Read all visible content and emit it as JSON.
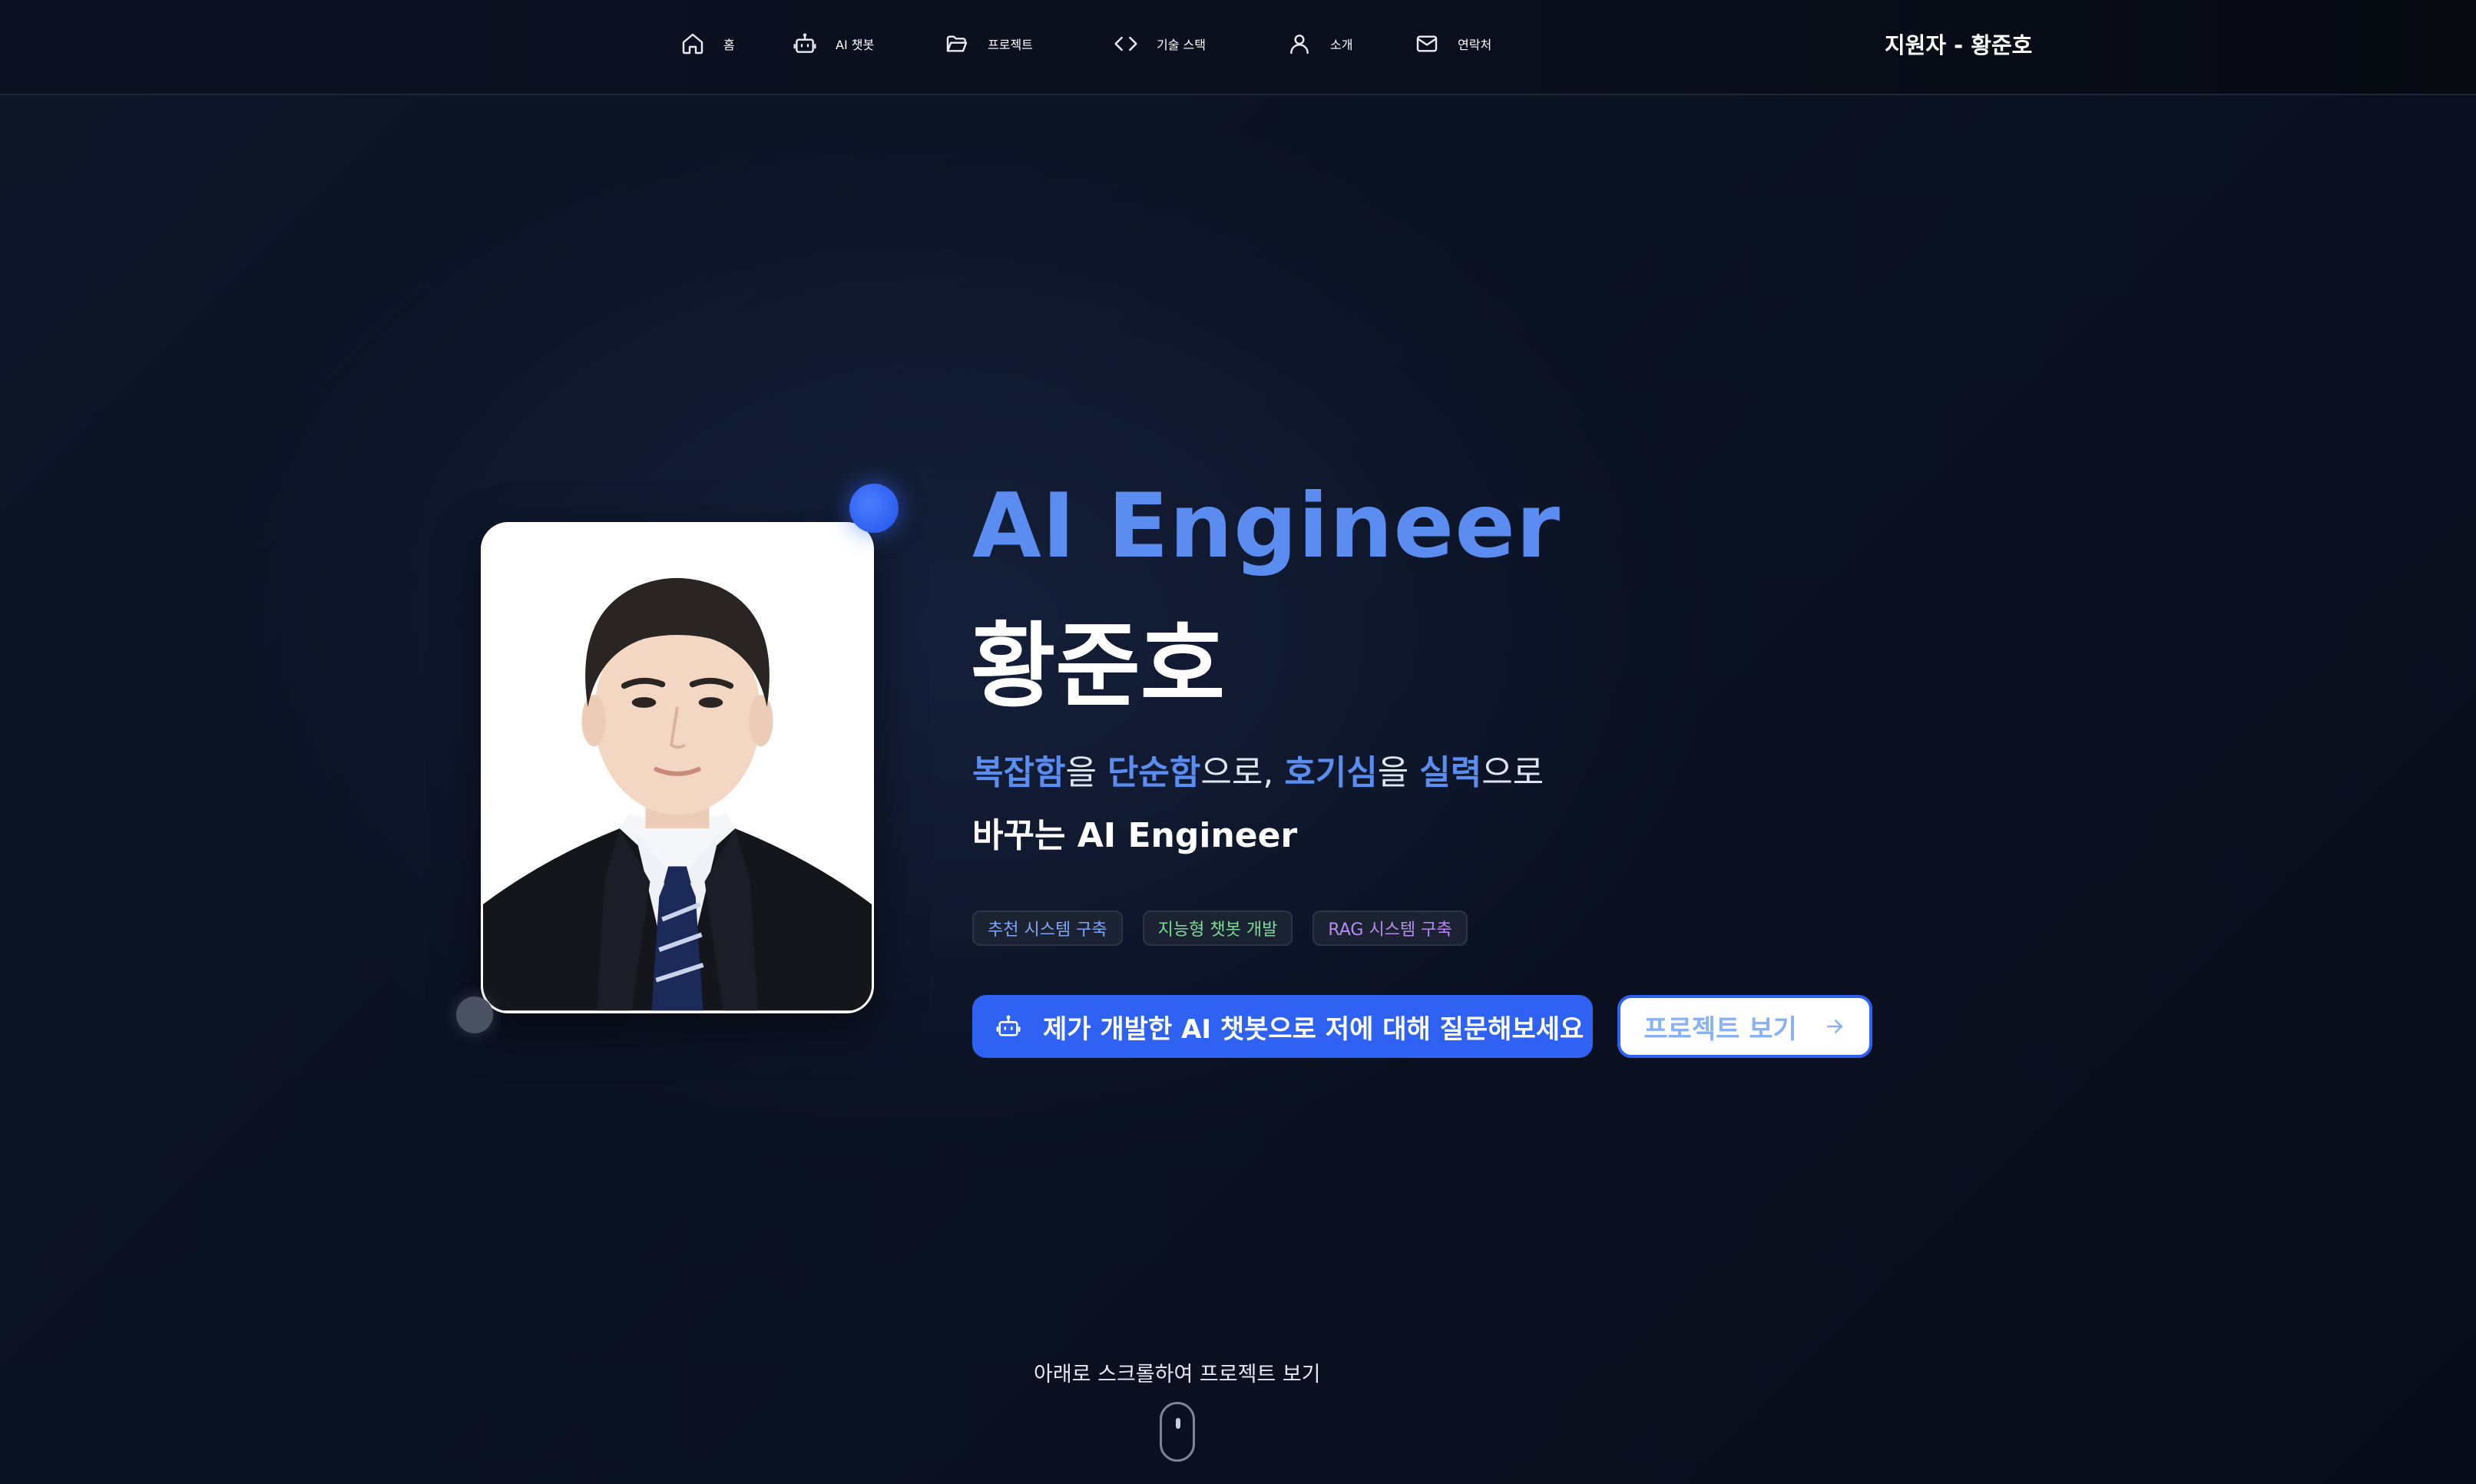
{
  "nav": {
    "items": [
      {
        "label": "홈",
        "icon": "home-icon"
      },
      {
        "label": "AI 챗봇",
        "icon": "bot-icon"
      },
      {
        "label": "프로젝트",
        "icon": "folder-open-icon"
      },
      {
        "label": "기술 스택",
        "icon": "code-icon"
      },
      {
        "label": "소개",
        "icon": "user-icon"
      },
      {
        "label": "연락처",
        "icon": "mail-icon"
      }
    ],
    "applicant": "지원자 - 황준호"
  },
  "hero": {
    "title_en": "AI Engineer",
    "title_name": "황준호",
    "tagline_line1": [
      {
        "text": "복잡함",
        "highlight": true
      },
      {
        "text": "을 ",
        "highlight": false
      },
      {
        "text": "단순함",
        "highlight": true
      },
      {
        "text": "으로, ",
        "highlight": false
      },
      {
        "text": "호기심",
        "highlight": true
      },
      {
        "text": "을 ",
        "highlight": false
      },
      {
        "text": "실력",
        "highlight": true
      },
      {
        "text": "으로",
        "highlight": false
      }
    ],
    "tagline_line2": "바꾸는 AI Engineer",
    "chips": [
      {
        "label": "추천 시스템 구축",
        "color": "#7fa6f6"
      },
      {
        "label": "지능형 챗봇 개발",
        "color": "#7edc98"
      },
      {
        "label": "RAG 시스템 구축",
        "color": "#b88bf2"
      }
    ],
    "primary_button": {
      "label": "제가 개발한 AI 챗봇으로 저에 대해 질문해보세요",
      "icon": "bot-icon"
    },
    "secondary_button": {
      "label": "프로젝트 보기",
      "icon": "arrow-right-icon"
    },
    "scroll_hint": "아래로 스크롤하여 프로젝트 보기"
  },
  "colors": {
    "accent": "#5b8df0",
    "primary_button": "#2f62f2",
    "background": "#0b1222"
  }
}
